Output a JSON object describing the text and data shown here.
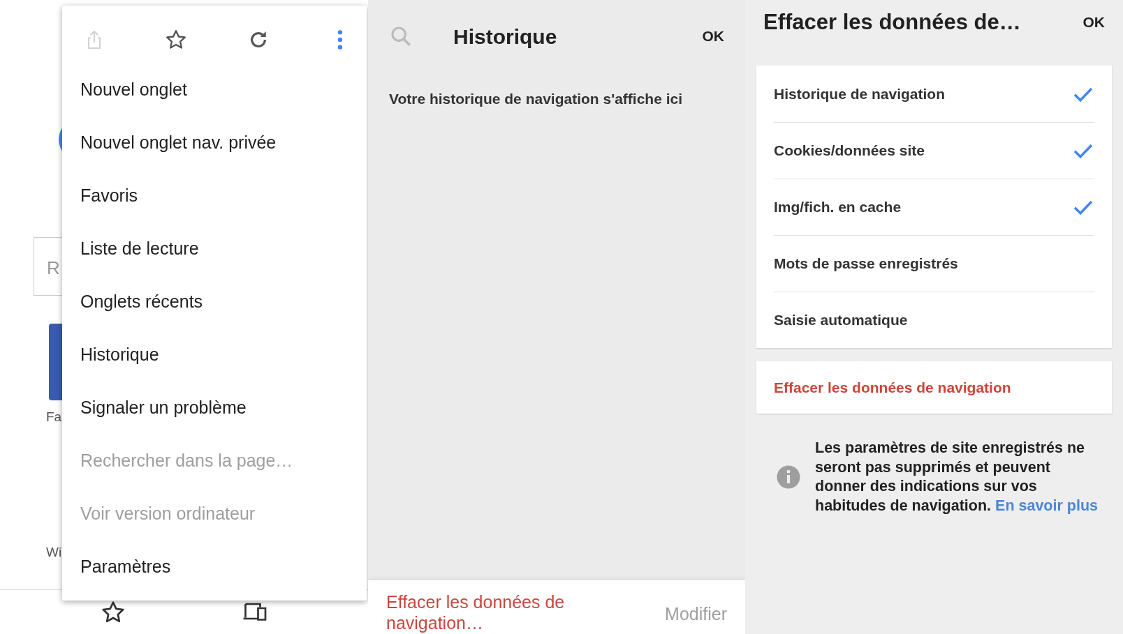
{
  "background_page": {
    "field_text": "R",
    "shortcut_label": "Fa",
    "link_label": "Wi"
  },
  "menu": {
    "toolbar": [
      {
        "kind": "share",
        "disabled": true
      },
      {
        "kind": "star",
        "disabled": false
      },
      {
        "kind": "reload",
        "disabled": false
      },
      {
        "kind": "more",
        "disabled": false
      }
    ],
    "items": [
      {
        "label": "Nouvel onglet",
        "disabled": false
      },
      {
        "label": "Nouvel onglet nav. privée",
        "disabled": false
      },
      {
        "label": "Favoris",
        "disabled": false
      },
      {
        "label": "Liste de lecture",
        "disabled": false
      },
      {
        "label": "Onglets récents",
        "disabled": false
      },
      {
        "label": "Historique",
        "disabled": false
      },
      {
        "label": "Signaler un problème",
        "disabled": false
      },
      {
        "label": "Rechercher dans la page…",
        "disabled": true
      },
      {
        "label": "Voir version ordinateur",
        "disabled": true
      },
      {
        "label": "Paramètres",
        "disabled": false
      }
    ]
  },
  "bottom_bar": [
    {
      "kind": "star"
    },
    {
      "kind": "devices"
    }
  ],
  "history": {
    "title": "Historique",
    "done": "OK",
    "empty_message": "Votre historique de navigation s'affiche ici",
    "clear_link": "Effacer les données de navigation…",
    "edit_button": "Modifier",
    "edit_disabled": true
  },
  "clear_data": {
    "title": "Effacer les données de…",
    "done": "OK",
    "options": [
      {
        "label": "Historique de navigation",
        "checked": true
      },
      {
        "label": "Cookies/données site",
        "checked": true
      },
      {
        "label": "Img/fich. en cache",
        "checked": true
      },
      {
        "label": "Mots de passe enregistrés",
        "checked": false
      },
      {
        "label": "Saisie automatique",
        "checked": false
      }
    ],
    "clear_button": "Effacer les données de navigation",
    "info_text": "Les paramètres de site enregistrés ne seront pas supprimés et peuvent donner des indications sur vos habitudes de navigation.",
    "info_link": "En savoir plus"
  }
}
